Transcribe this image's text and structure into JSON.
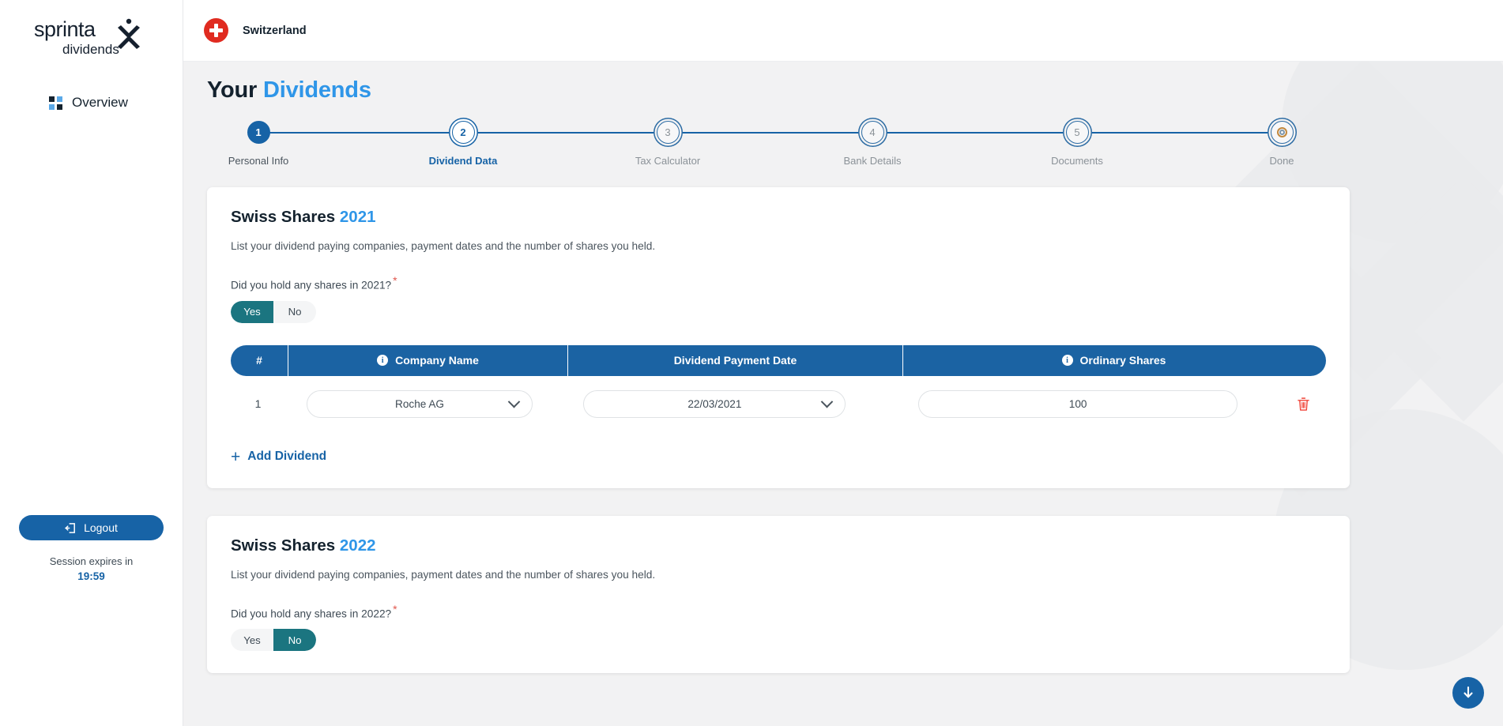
{
  "brand": {
    "name": "sprintax",
    "sub": "dividends"
  },
  "sidebar": {
    "nav": [
      {
        "label": "Overview",
        "icon": "grid-icon"
      }
    ],
    "logout_label": "Logout",
    "session_text": "Session expires in",
    "session_time": "19:59"
  },
  "topbar": {
    "country": "Switzerland",
    "flag": "switzerland-flag-icon"
  },
  "page": {
    "title_main": "Your",
    "title_highlight": "Dividends"
  },
  "stepper": {
    "steps": [
      {
        "num": "1",
        "label": "Personal Info",
        "state": "done"
      },
      {
        "num": "2",
        "label": "Dividend Data",
        "state": "current"
      },
      {
        "num": "3",
        "label": "Tax Calculator",
        "state": "pending"
      },
      {
        "num": "4",
        "label": "Bank Details",
        "state": "pending"
      },
      {
        "num": "5",
        "label": "Documents",
        "state": "pending"
      },
      {
        "num": "",
        "label": "Done",
        "state": "pending"
      }
    ]
  },
  "cards": [
    {
      "title": "Swiss Shares",
      "year": "2021",
      "subtitle": "List your dividend paying companies, payment dates and the number of shares you held.",
      "question": "Did you hold any shares in 2021?",
      "toggle": {
        "yes": "Yes",
        "no": "No",
        "selected": "Yes"
      },
      "table": {
        "headers": {
          "num": "#",
          "company": "Company Name",
          "date": "Dividend Payment Date",
          "shares": "Ordinary Shares"
        },
        "rows": [
          {
            "num": "1",
            "company": "Roche AG",
            "date": "22/03/2021",
            "shares": "100"
          }
        ]
      },
      "add_label": "Add Dividend"
    },
    {
      "title": "Swiss Shares",
      "year": "2022",
      "subtitle": "List your dividend paying companies, payment dates and the number of shares you held.",
      "question": "Did you hold any shares in 2022?",
      "toggle": {
        "yes": "Yes",
        "no": "No",
        "selected": "No"
      }
    }
  ],
  "fab": {
    "icon": "download-arrow-icon"
  },
  "colors": {
    "primary_blue": "#1763a6",
    "accent_blue": "#2f96e8",
    "teal": "#1b7580",
    "table_header": "#1b63a3",
    "red_flag": "#e02b20",
    "trash_red": "#f04438",
    "content_bg": "#f2f2f3"
  }
}
